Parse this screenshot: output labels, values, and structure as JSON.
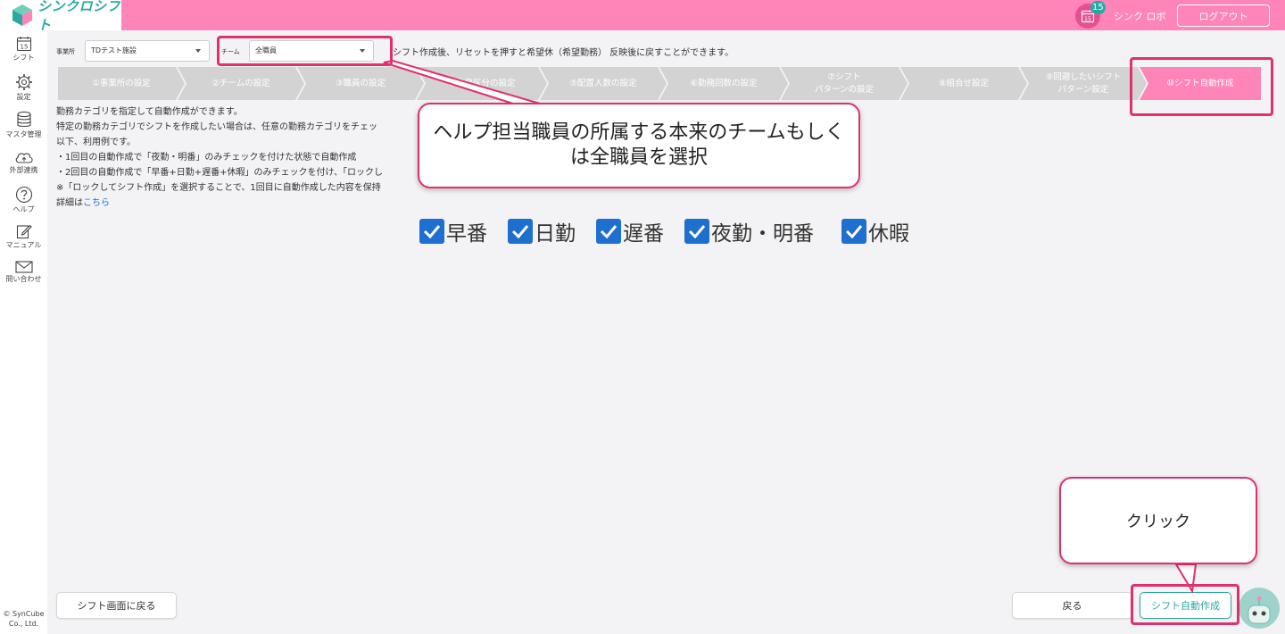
{
  "header": {
    "logo_text": "シンクロシフト",
    "calendar_icon_text": "15",
    "badge_count": "15",
    "user_name": "シンク ロボ",
    "logout_label": "ログアウト",
    "bg_color": "#ff85b8"
  },
  "sidebar": {
    "items": [
      {
        "label": "シフト",
        "icon": "calendar-icon"
      },
      {
        "label": "設定",
        "icon": "gear-icon"
      },
      {
        "label": "マスタ管理",
        "icon": "database-icon"
      },
      {
        "label": "外部連携",
        "icon": "cloud-icon"
      },
      {
        "label": "ヘルプ",
        "icon": "help-icon"
      },
      {
        "label": "マニュアル",
        "icon": "manual-icon"
      },
      {
        "label": "問い合わせ",
        "icon": "mail-icon"
      }
    ],
    "calendar_day": "15",
    "copyright_line1": "© SynCube",
    "copyright_line2": "Co., Ltd."
  },
  "filters": {
    "office_label": "事業所",
    "office_value": "TDテスト施設",
    "team_label": "チーム",
    "team_value": "全職員",
    "reset_note": "シフト作成後、リセットを押すと希望休（希望勤務） 反映後に戻すことができます。"
  },
  "steps": [
    {
      "line1": "①事業所の設定",
      "line2": ""
    },
    {
      "line1": "②チームの設定",
      "line2": ""
    },
    {
      "line1": "③職員の設定",
      "line2": ""
    },
    {
      "line1": "④勤務区分の設定",
      "line2": ""
    },
    {
      "line1": "⑤配置人数の設定",
      "line2": ""
    },
    {
      "line1": "⑥勤務回数の設定",
      "line2": ""
    },
    {
      "line1": "⑦シフト",
      "line2": "パターンの設定"
    },
    {
      "line1": "⑧組合せ設定",
      "line2": ""
    },
    {
      "line1": "⑨回避したいシフト",
      "line2": "パターン設定"
    },
    {
      "line1": "⑩シフト自動作成",
      "line2": ""
    }
  ],
  "description": {
    "line1": "勤務カテゴリを指定して自動作成ができます。",
    "line2": "特定の勤務カテゴリでシフトを作成したい場合は、任意の勤務カテゴリをチェッ",
    "line3": "以下、利用例です。",
    "line4": "・1回目の自動作成で「夜勤・明番」のみチェックを付けた状態で自動作成",
    "line5": "・2回目の自動作成で「早番+日勤+遅番+休暇」のみチェックを付け、「ロックし",
    "line6": "※「ロックしてシフト作成」を選択することで、1回目に自動作成した内容を保持",
    "details_prefix": "詳細は",
    "details_link": "こちら"
  },
  "categories": [
    {
      "label": "早番",
      "checked": true
    },
    {
      "label": "日勤",
      "checked": true
    },
    {
      "label": "遅番",
      "checked": true
    },
    {
      "label": "夜勤・明番",
      "checked": true
    },
    {
      "label": "休暇",
      "checked": true
    }
  ],
  "footer": {
    "back_to_shift_label": "シフト画面に戻る",
    "back_label": "戻る",
    "auto_create_label": "シフト自動作成"
  },
  "annotations": {
    "team_callout": "ヘルプ担当職員の所属する本来のチームもしくは全職員を選択",
    "click_callout": "クリック",
    "highlight_color": "#e0306e"
  }
}
